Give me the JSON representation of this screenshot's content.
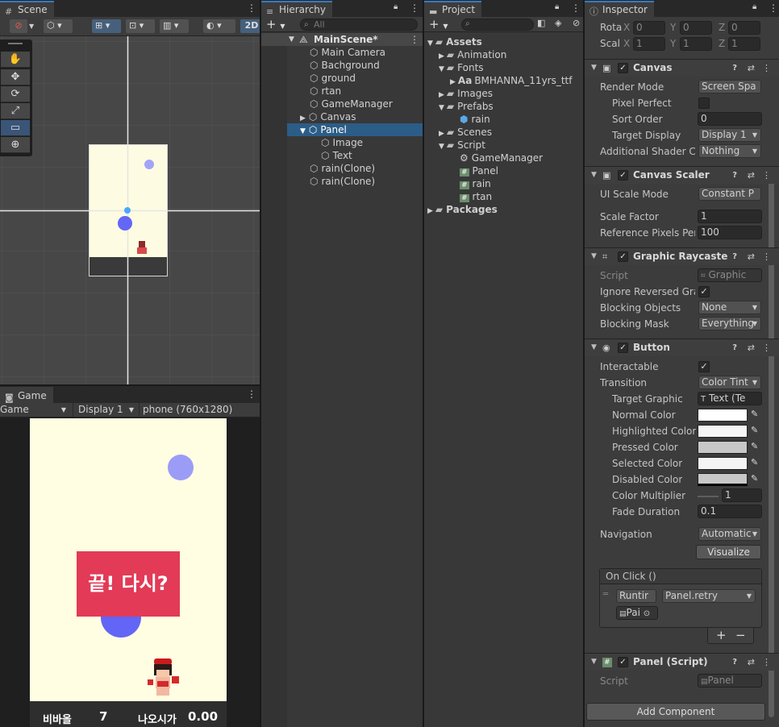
{
  "scene": {
    "tab_label": "Scene",
    "mode_2d": "2D",
    "tools": [
      "✋",
      "✥",
      "⟳",
      "⤢",
      "▭",
      "⊕"
    ]
  },
  "game": {
    "tab_label": "Game",
    "view_select": "Game",
    "display_select": "Display 1",
    "resolution_select": "phone (760x1280)",
    "panel_text": "끝! 다시?",
    "footer_label_left": "비바올",
    "footer_value_left": "7",
    "footer_label_right": "나오시가",
    "footer_value_right": "0.00"
  },
  "hierarchy": {
    "tab_label": "Hierarchy",
    "add_label": "+",
    "search_placeholder": "All",
    "scene_name": "MainScene*",
    "items": [
      {
        "label": "Main Camera"
      },
      {
        "label": "Bachground"
      },
      {
        "label": "ground"
      },
      {
        "label": "rtan"
      },
      {
        "label": "GameManager"
      },
      {
        "label": "Canvas"
      },
      {
        "label": "Panel"
      },
      {
        "label": "Image"
      },
      {
        "label": "Text"
      },
      {
        "label": "rain(Clone)"
      },
      {
        "label": "rain(Clone)"
      }
    ]
  },
  "project": {
    "tab_label": "Project",
    "add_label": "+",
    "assets_label": "Assets",
    "items": [
      {
        "label": "Animation"
      },
      {
        "label": "Fonts"
      },
      {
        "label": "BMHANNA_11yrs_ttf"
      },
      {
        "label": "Images"
      },
      {
        "label": "Prefabs"
      },
      {
        "label": "rain"
      },
      {
        "label": "Scenes"
      },
      {
        "label": "Script"
      },
      {
        "label": "GameManager"
      },
      {
        "label": "Panel"
      },
      {
        "label": "rain"
      },
      {
        "label": "rtan"
      },
      {
        "label": "Packages"
      }
    ]
  },
  "inspector": {
    "tab_label": "Inspector",
    "rotation_label": "Rota",
    "scale_label": "Scal",
    "rotation": {
      "x": "0",
      "y": "0",
      "z": "0"
    },
    "scale": {
      "x": "1",
      "y": "1",
      "z": "1"
    },
    "canvas": {
      "title": "Canvas",
      "render_mode_label": "Render Mode",
      "render_mode_value": "Screen Spa",
      "pixel_perfect_label": "Pixel Perfect",
      "sort_order_label": "Sort Order",
      "sort_order_value": "0",
      "target_display_label": "Target Display",
      "target_display_value": "Display 1",
      "shader_label": "Additional Shader Ch",
      "shader_value": "Nothing"
    },
    "scaler": {
      "title": "Canvas Scaler",
      "ui_scale_label": "UI Scale Mode",
      "ui_scale_value": "Constant P",
      "scale_factor_label": "Scale Factor",
      "scale_factor_value": "1",
      "ref_pixels_label": "Reference Pixels Per",
      "ref_pixels_value": "100"
    },
    "raycaster": {
      "title": "Graphic Raycaste",
      "script_label": "Script",
      "script_value": "Graphic",
      "ignore_label": "Ignore Reversed Grap",
      "blocking_objects_label": "Blocking Objects",
      "blocking_objects_value": "None",
      "blocking_mask_label": "Blocking Mask",
      "blocking_mask_value": "Everything"
    },
    "button": {
      "title": "Button",
      "interactable_label": "Interactable",
      "transition_label": "Transition",
      "transition_value": "Color Tint",
      "target_graphic_label": "Target Graphic",
      "target_graphic_value": "Text (Te",
      "normal_label": "Normal Color",
      "highlighted_label": "Highlighted Color",
      "pressed_label": "Pressed Color",
      "selected_label": "Selected Color",
      "disabled_label": "Disabled Color",
      "multiplier_label": "Color Multiplier",
      "multiplier_value": "1",
      "fade_label": "Fade Duration",
      "fade_value": "0.1",
      "navigation_label": "Navigation",
      "navigation_value": "Automatic",
      "visualize_label": "Visualize",
      "onclick_label": "On Click ()",
      "runtime_value": "Runtir",
      "function_value": "Panel.retry",
      "object_value": "Pai",
      "plus_label": "+",
      "minus_label": "−"
    },
    "panel_script": {
      "title": "Panel (Script)",
      "script_label": "Script",
      "script_value": "Panel"
    },
    "add_component_label": "Add Component"
  },
  "colors": {
    "accent": "#3a79bb",
    "game_bg": "#fffde2",
    "panel_red": "#e23a57",
    "ball_light": "#9b9cf6",
    "ball_dark": "#6265f6"
  }
}
